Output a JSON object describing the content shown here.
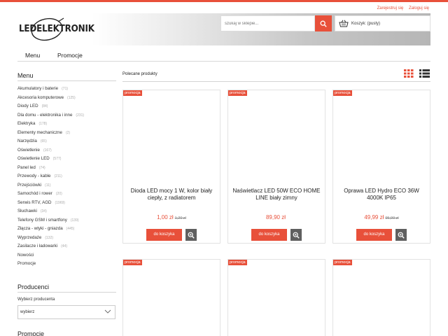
{
  "top_links": {
    "register": "Zarejestruj się",
    "login": "Zaloguj się"
  },
  "logo": {
    "text": "LEDELEKTRONIK"
  },
  "search": {
    "placeholder": "szukaj w sklepie..."
  },
  "cart": {
    "label": "Koszyk: (pusty)"
  },
  "nav": {
    "menu": "Menu",
    "promotions": "Promocje"
  },
  "sidebar": {
    "menu_title": "Menu",
    "categories": [
      {
        "label": "Akumulatory i baterie",
        "count": "(71)"
      },
      {
        "label": "Akcesoria komputerowe",
        "count": "(125)"
      },
      {
        "label": "Diody LED",
        "count": "(84)"
      },
      {
        "label": "Dla domu - elektronika i inne",
        "count": "(231)"
      },
      {
        "label": "Elektryka",
        "count": "(178)"
      },
      {
        "label": "Elementy mechaniczne",
        "count": "(2)"
      },
      {
        "label": "Narzędzia",
        "count": "(65)"
      },
      {
        "label": "Oświetlenie",
        "count": "(167)"
      },
      {
        "label": "Oświetlenie LED",
        "count": "(577)"
      },
      {
        "label": "Panel led",
        "count": "(74)"
      },
      {
        "label": "Przewody - kable",
        "count": "(211)"
      },
      {
        "label": "Przejściówki",
        "count": "(11)"
      },
      {
        "label": "Samochód i rower",
        "count": "(20)"
      },
      {
        "label": "Serwis RTV, AGD",
        "count": "(1969)"
      },
      {
        "label": "Słuchawki",
        "count": "(34)"
      },
      {
        "label": "Telefony GSM i smartfony",
        "count": "(139)"
      },
      {
        "label": "Złącza - wtyki - gniazda",
        "count": "(445)"
      },
      {
        "label": "Wyprzedaże",
        "count": "(132)"
      },
      {
        "label": "Zasilacze i ładowarki",
        "count": "(44)"
      },
      {
        "label": "Nowości",
        "count": ""
      },
      {
        "label": "Promocje",
        "count": ""
      }
    ],
    "producers_title": "Producenci",
    "producer_label": "Wybierz producenta",
    "producer_select": "wybierz",
    "promo_title": "Promocje"
  },
  "main": {
    "heading": "Polecane produkty",
    "products": [
      {
        "badge": "promocja",
        "name": "Dioda LED mocy 1 W, kolor biały ciepły, z radiatorem",
        "price": "1,00 zł",
        "old_price": "1,20 zł",
        "buy": "do koszyka"
      },
      {
        "badge": "promocja",
        "name": "Naświetlacz LED 50W ECO HOME LINE biały zimny",
        "price": "89,90 zł",
        "old_price": "",
        "buy": "do koszyka"
      },
      {
        "badge": "promocja",
        "name": "Oprawa LED Hydro ECO 36W 4000K IP65",
        "price": "49,99 zł",
        "old_price": "95,99 zł",
        "buy": "do koszyka"
      },
      {
        "badge": "promocja"
      },
      {
        "badge": "promocja"
      },
      {
        "badge": "promocja"
      }
    ]
  },
  "colors": {
    "accent": "#e8503a",
    "zoom_button": "#5f5f5f"
  },
  "icons": [
    "search-icon",
    "basket-icon",
    "grid-view-icon",
    "list-view-icon",
    "zoom-icon",
    "chevron-down-icon"
  ]
}
